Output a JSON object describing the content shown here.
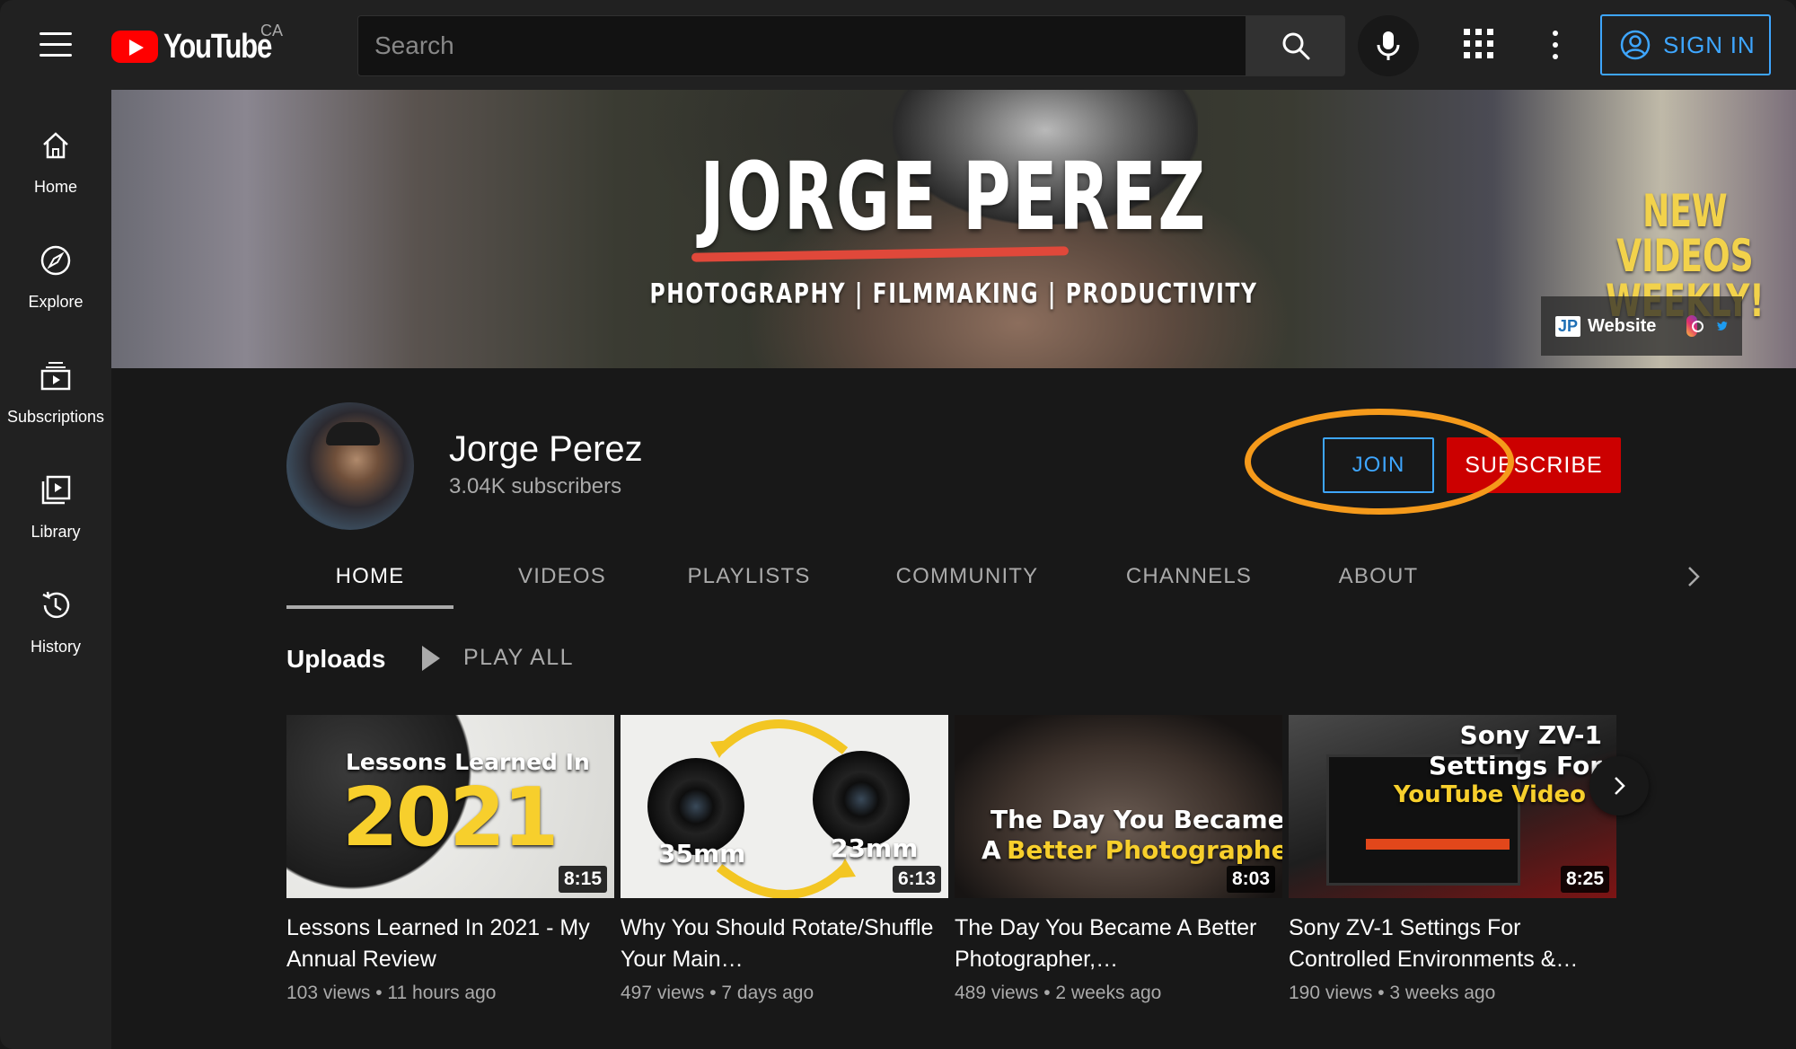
{
  "header": {
    "logo_text": "YouTube",
    "country": "CA",
    "search_placeholder": "Search",
    "sign_in_label": "SIGN IN"
  },
  "sidebar": {
    "items": [
      {
        "label": "Home",
        "icon": "home-icon"
      },
      {
        "label": "Explore",
        "icon": "compass-icon"
      },
      {
        "label": "Subscriptions",
        "icon": "subscriptions-icon"
      },
      {
        "label": "Library",
        "icon": "library-icon"
      },
      {
        "label": "History",
        "icon": "history-icon"
      }
    ]
  },
  "banner": {
    "title": "JORGE PEREZ",
    "tagline": "PHOTOGRAPHY | FILMMAKING | PRODUCTIVITY",
    "promo_line1": "NEW VIDEOS",
    "promo_line2": "WEEKLY!",
    "website_badge": "JP",
    "website_label": "Website"
  },
  "channel": {
    "name": "Jorge Perez",
    "subscribers": "3.04K subscribers",
    "join_label": "JOIN",
    "subscribe_label": "SUBSCRIBE"
  },
  "tabs": [
    {
      "label": "HOME",
      "active": true
    },
    {
      "label": "VIDEOS",
      "active": false
    },
    {
      "label": "PLAYLISTS",
      "active": false
    },
    {
      "label": "COMMUNITY",
      "active": false
    },
    {
      "label": "CHANNELS",
      "active": false
    },
    {
      "label": "ABOUT",
      "active": false
    }
  ],
  "uploads": {
    "title": "Uploads",
    "play_all_label": "PLAY ALL",
    "videos": [
      {
        "title": "Lessons Learned In 2021 - My Annual Review",
        "duration": "8:15",
        "views": "103 views",
        "age": "11 hours ago",
        "thumb_text": [
          "Lessons Learned In",
          "2021"
        ]
      },
      {
        "title": "Why You Should Rotate/Shuffle Your Main…",
        "duration": "6:13",
        "views": "497 views",
        "age": "7 days ago",
        "thumb_text": [
          "35mm",
          "23mm"
        ]
      },
      {
        "title": "The Day You Became A Better Photographer,…",
        "duration": "8:03",
        "views": "489 views",
        "age": "2 weeks ago",
        "thumb_text": [
          "The Day You Became",
          "A",
          "Better Photographer"
        ]
      },
      {
        "title": "Sony ZV-1 Settings For Controlled Environments &…",
        "duration": "8:25",
        "views": "190 views",
        "age": "3 weeks ago",
        "thumb_text": [
          "Sony ZV-1",
          "Settings For",
          "YouTube Video"
        ]
      }
    ]
  },
  "colors": {
    "accent_blue": "#3ea6ff",
    "subscribe_red": "#cc0000",
    "highlight_orange": "#f59a1b",
    "promo_yellow": "#f2d24b"
  }
}
